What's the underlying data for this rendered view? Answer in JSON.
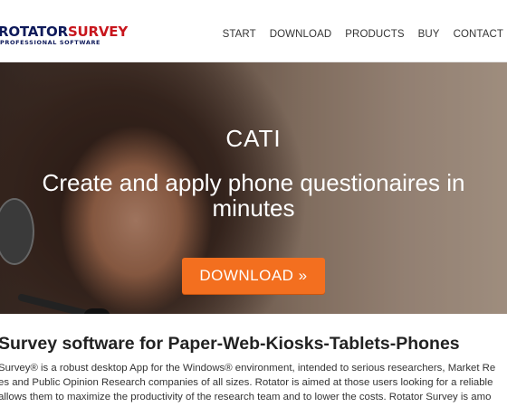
{
  "header": {
    "logo_main_part1": "ROTATOR",
    "logo_main_part2": "SURVEY",
    "logo_sub": "PROFESSIONAL SOFTWARE",
    "nav": [
      {
        "label": "START"
      },
      {
        "label": "DOWNLOAD"
      },
      {
        "label": "PRODUCTS"
      },
      {
        "label": "BUY"
      },
      {
        "label": "CONTACT"
      }
    ]
  },
  "hero": {
    "title": "CATI",
    "subtitle": "Create and apply phone questionaires in minutes",
    "button_label": "DOWNLOAD »"
  },
  "content": {
    "heading": "Survey software for Paper-Web-Kiosks-Tablets-Phones",
    "lines": [
      "Survey® is a robust desktop App for the Windows® environment, intended to serious researchers, Market Re",
      "es and Public Opinion Research companies of all sizes. Rotator is aimed at those users looking for a reliable",
      "allows them to maximize the productivity of the research team and to lower the costs. Rotator Survey is amo"
    ]
  },
  "colors": {
    "accent_orange": "#f36f1f",
    "logo_blue": "#0e1a5a",
    "logo_red": "#c8161d"
  }
}
